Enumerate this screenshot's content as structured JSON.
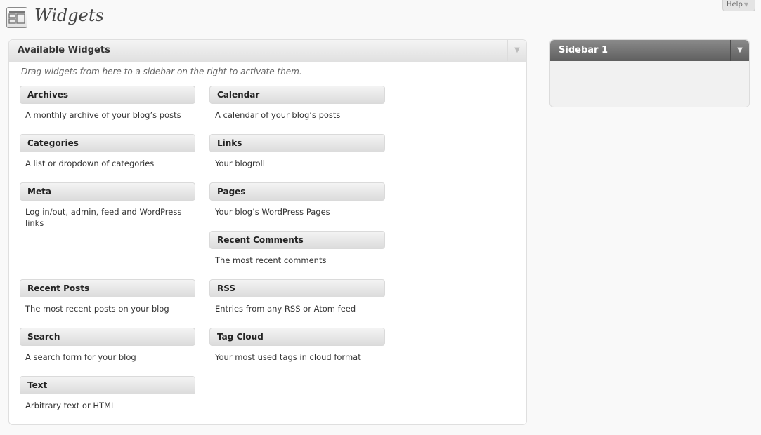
{
  "header": {
    "title": "Widgets",
    "icon": "widgets-icon",
    "help_label": "Help"
  },
  "available": {
    "title": "Available Widgets",
    "intro": "Drag widgets from here to a sidebar on the right to activate them.",
    "widgets": [
      {
        "title": "Archives",
        "desc": "A monthly archive of your blog’s posts"
      },
      {
        "title": "Calendar",
        "desc": "A calendar of your blog’s posts"
      },
      {
        "title": "Categories",
        "desc": "A list or dropdown of categories"
      },
      {
        "title": "Links",
        "desc": "Your blogroll"
      },
      {
        "title": "Meta",
        "desc": "Log in/out, admin, feed and WordPress links"
      },
      {
        "title": "Pages",
        "desc": "Your blog’s WordPress Pages"
      },
      {
        "title": "Recent Comments",
        "desc": "The most recent comments"
      },
      {
        "title": "Recent Posts",
        "desc": "The most recent posts on your blog"
      },
      {
        "title": "RSS",
        "desc": "Entries from any RSS or Atom feed"
      },
      {
        "title": "Search",
        "desc": "A search form for your blog"
      },
      {
        "title": "Tag Cloud",
        "desc": "Your most used tags in cloud format"
      },
      {
        "title": "Text",
        "desc": "Arbitrary text or HTML"
      }
    ]
  },
  "sidebar": {
    "title": "Sidebar 1"
  },
  "colors": {
    "sidebar_header": "#6d6d6d",
    "widget_header": "#e4e4e4",
    "background": "#f9f9f9"
  }
}
